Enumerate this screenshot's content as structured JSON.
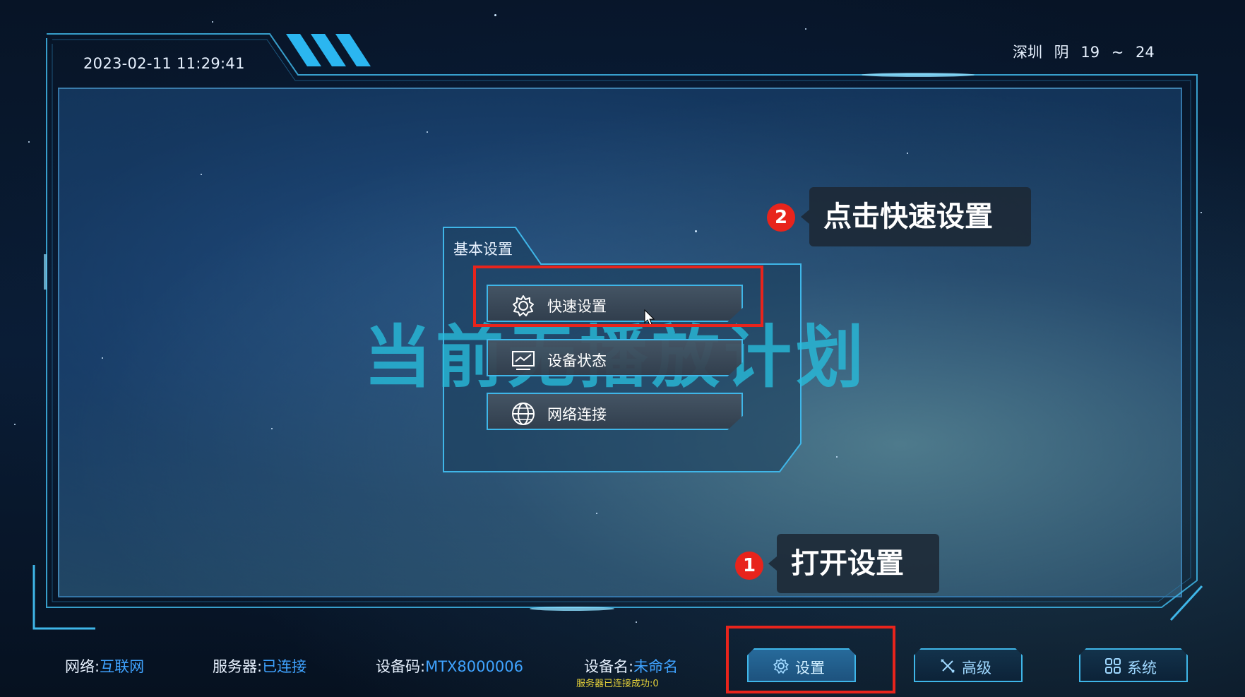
{
  "header": {
    "datetime": "2023-02-11 11:29:41",
    "weather": "深圳 阴 19 ~ 24"
  },
  "background_title": "当前无播放计划",
  "menu": {
    "tab_label": "基本设置",
    "items": [
      {
        "label": "快速设置",
        "icon": "gear-icon"
      },
      {
        "label": "设备状态",
        "icon": "monitor-icon"
      },
      {
        "label": "网络连接",
        "icon": "globe-icon"
      }
    ]
  },
  "annotations": {
    "step1": {
      "num": "1",
      "text": "打开设置"
    },
    "step2": {
      "num": "2",
      "text": "点击快速设置"
    }
  },
  "status": {
    "network_label": "网络:",
    "network_value": "互联网",
    "server_label": "服务器:",
    "server_value": "已连接",
    "device_code_label": "设备码:",
    "device_code_value": "MTX8000006",
    "device_name_label": "设备名:",
    "device_name_value": "未命名",
    "sub_status": "服务器已连接成功:0"
  },
  "nav": {
    "settings": {
      "label": "设置",
      "icon": "gear-icon"
    },
    "advanced": {
      "label": "高级",
      "icon": "tools-icon"
    },
    "system": {
      "label": "系统",
      "icon": "grid-icon"
    }
  },
  "colors": {
    "accent": "#3fb6e8",
    "status_value": "#3fa3ff",
    "annotation_red": "#e8241c",
    "sub_status": "#e6d23a"
  }
}
